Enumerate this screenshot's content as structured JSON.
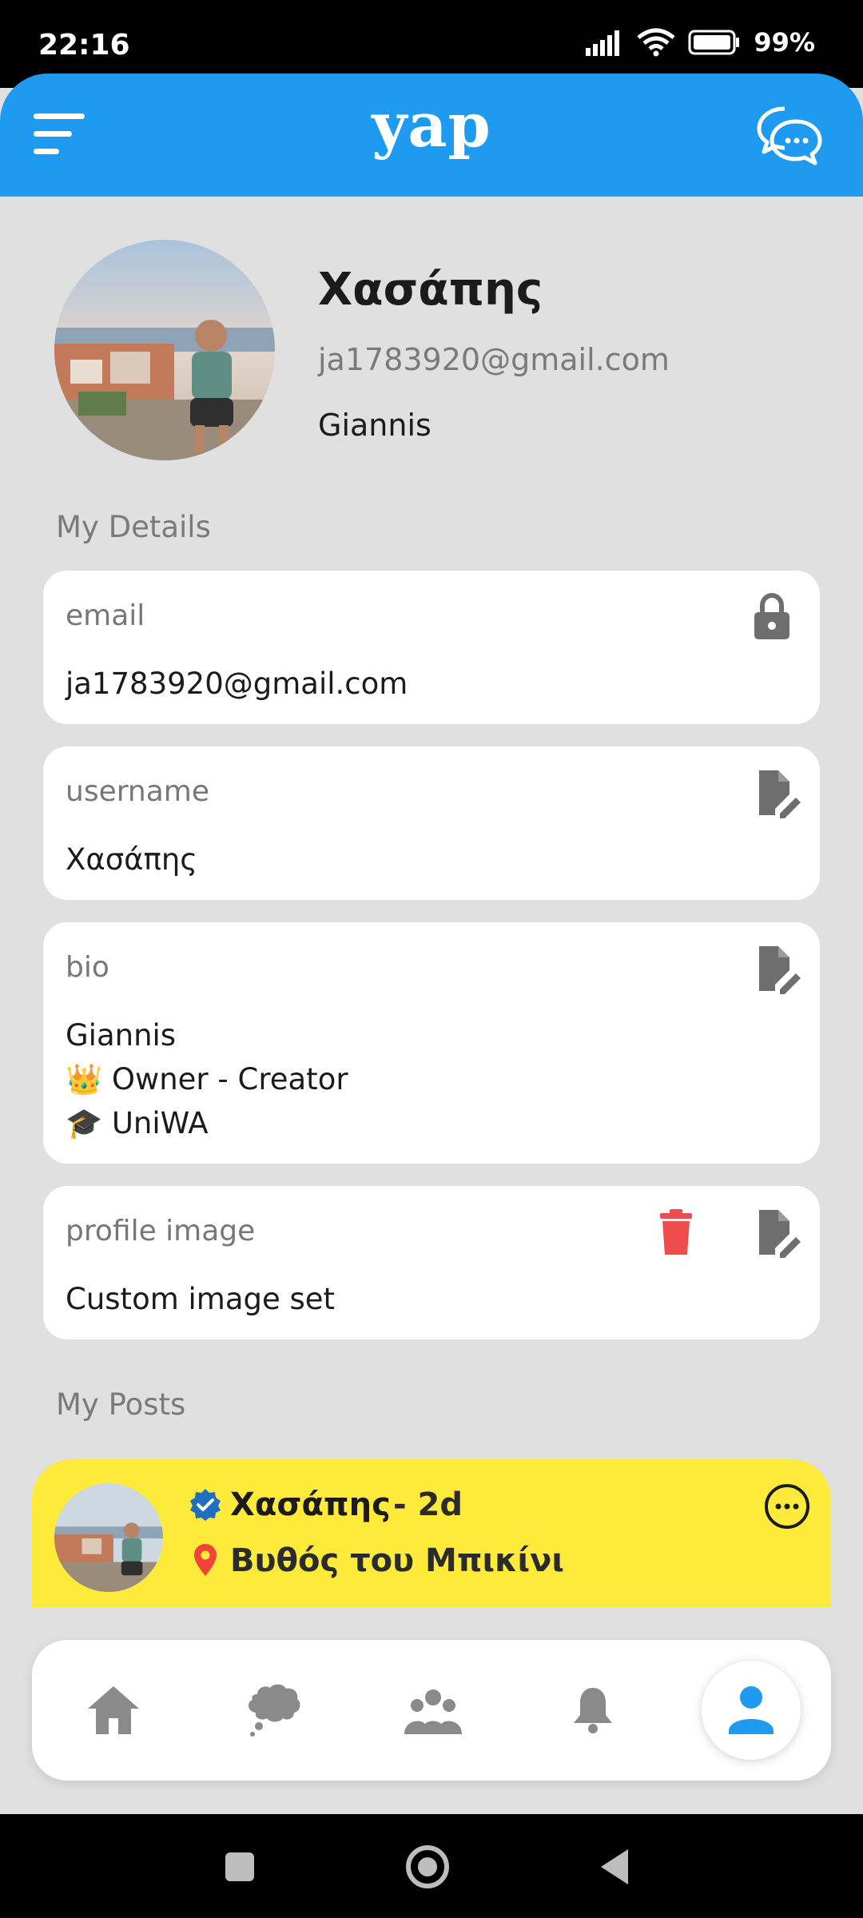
{
  "status_bar": {
    "time": "22:16",
    "battery": "99%"
  },
  "header": {
    "title": "yap"
  },
  "profile": {
    "name": "Χασάπης",
    "email": "ja1783920@gmail.com",
    "bio_first_line": "Giannis"
  },
  "sections": {
    "details_title": "My Details",
    "posts_title": "My Posts"
  },
  "details": {
    "email": {
      "label": "email",
      "value": "ja1783920@gmail.com"
    },
    "username": {
      "label": "username",
      "value": "Χασάπης"
    },
    "bio": {
      "label": "bio",
      "lines": [
        "Giannis",
        "👑 Owner - Creator",
        "🎓 UniWA"
      ]
    },
    "profile_image": {
      "label": "profile image",
      "value": "Custom image set"
    }
  },
  "post": {
    "author": "Χασάπης",
    "time": "- 2d",
    "location": "Βυθός του Μπικίνι"
  },
  "colors": {
    "accent": "#1e9bf0",
    "post_bg": "#fdea3b",
    "delete": "#ef4d4d",
    "icon_gray": "#6e6e6e"
  }
}
